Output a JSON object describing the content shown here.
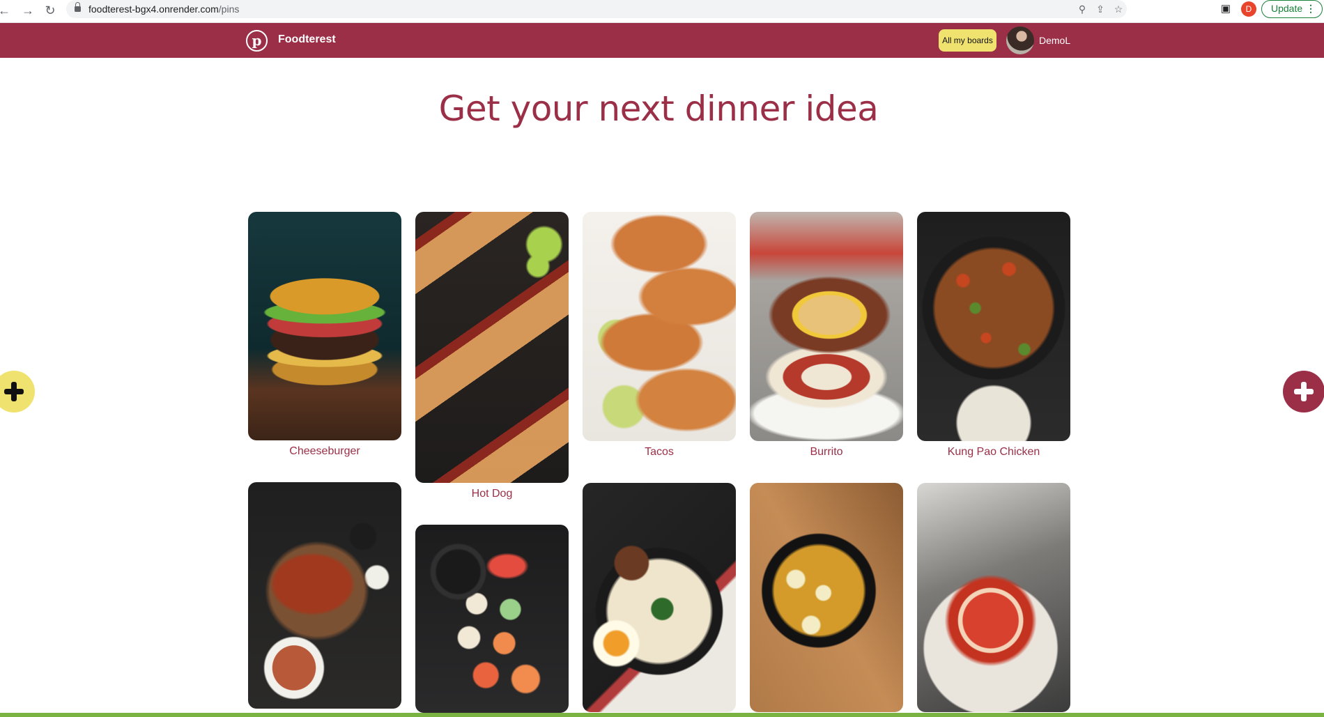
{
  "browser": {
    "url_host": "foodterest-bgx4.onrender.com",
    "url_path": "/pins",
    "profile_initial": "D",
    "update_label": "Update"
  },
  "header": {
    "brand": "Foodterest",
    "boards_button": "All my boards",
    "username": "DemoL",
    "bg_color": "#9b2f47",
    "accent_color": "#f0e26f"
  },
  "main": {
    "headline": "Get your next dinner idea"
  },
  "pins": [
    {
      "label": "Cheeseburger"
    },
    {
      "label": "Hot Dog"
    },
    {
      "label": "Tacos"
    },
    {
      "label": "Burrito"
    },
    {
      "label": "Kung Pao Chicken"
    },
    {
      "label": ""
    },
    {
      "label": ""
    },
    {
      "label": ""
    },
    {
      "label": ""
    },
    {
      "label": ""
    }
  ],
  "icons": [
    "back-arrow-icon",
    "forward-arrow-icon",
    "reload-icon",
    "lock-icon",
    "key-icon",
    "share-icon",
    "star-icon",
    "side-panel-icon",
    "pinterest-logo-icon",
    "plus-icon"
  ]
}
